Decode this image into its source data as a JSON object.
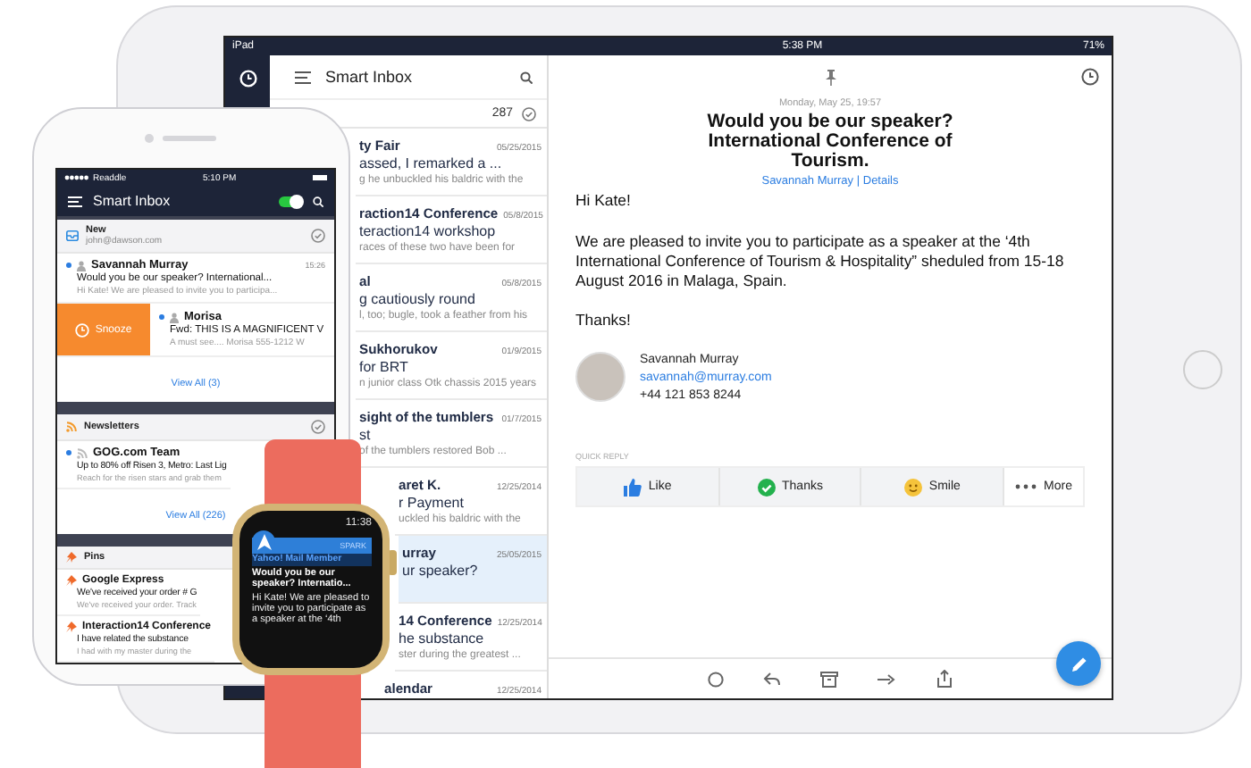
{
  "ipad": {
    "status_bar": {
      "device": "iPad",
      "time": "5:38 PM",
      "battery": "71%"
    },
    "inbox": {
      "title": "Smart Inbox",
      "count": "287",
      "messages": [
        {
          "sender": "ty Fair",
          "subject": "assed, I remarked a ...",
          "preview": "g he unbuckled his baldric with the",
          "date": "05/25/2015",
          "selected": false
        },
        {
          "sender": "raction14 Conference",
          "subject": "teraction14 workshop",
          "preview": "races of these two have been for",
          "date": "05/8/2015",
          "selected": false
        },
        {
          "sender": "al",
          "subject": "g cautiously round",
          "preview": "l, too; bugle, took a feather from his",
          "date": "05/8/2015",
          "selected": false
        },
        {
          "sender": "Sukhorukov",
          "subject": "for BRT",
          "preview": "n junior class Otk chassis 2015 years",
          "date": "01/9/2015",
          "selected": false
        },
        {
          "sender": "sight of the tumblers",
          "subject": "st",
          "preview": "of the tumblers restored Bob ...",
          "date": "01/7/2015",
          "selected": false
        },
        {
          "sender": "aret K.",
          "subject": "r Payment",
          "preview": "uckled his baldric with the",
          "date": "12/25/2014",
          "selected": false
        },
        {
          "sender": "urray",
          "subject": "ur speaker?",
          "date": "25/05/2015",
          "selected": true
        },
        {
          "sender": "14 Conference",
          "subject": "he substance",
          "preview": "ster during the greatest ...",
          "date": "12/25/2014",
          "selected": false
        },
        {
          "sender": "alendar",
          "date": "12/25/2014",
          "selected": false
        }
      ]
    },
    "email": {
      "date": "Monday, May 25, 19:57",
      "subject": "Would you be our speaker? International Conference of Tourism.",
      "sender_link": "Savannah Murray",
      "separator": "|",
      "details_link": "Details",
      "greeting": "Hi Kate!",
      "body": "We are pleased to invite you to participate as a speaker at the ‘4th International Conference of Tourism & Hospitality” sheduled from 15-18 August 2016 in Malaga, Spain.",
      "closing": "Thanks!",
      "signature": {
        "name": "Savannah Murray",
        "email": "savannah@murray.com",
        "phone": "+44 121 853 8244"
      },
      "quick_reply": {
        "label": "QUICK REPLY",
        "options": [
          {
            "kind": "like",
            "label": "Like"
          },
          {
            "kind": "thanks",
            "label": "Thanks"
          },
          {
            "kind": "smile",
            "label": "Smile"
          },
          {
            "kind": "more",
            "label": "More"
          }
        ]
      }
    }
  },
  "phone": {
    "status_bar": {
      "carrier": "Readdle",
      "time": "5:10 PM"
    },
    "title": "Smart Inbox",
    "toggle_on": true,
    "cards": [
      {
        "kind": "new",
        "title": "New",
        "subtitle": "john@dawson.com",
        "messages": [
          {
            "sender": "Savannah Murray",
            "time": "15:26",
            "subject": "Would you be our speaker? International...",
            "preview": "Hi Kate! We are pleased to invite you to participa...",
            "unread": true
          },
          {
            "sender": "Morisa",
            "subject": "Fwd: THIS IS A MAGNIFICENT V",
            "preview": "A must see.... Morisa 555-1212 W",
            "unread": true,
            "swipe_action": "Snooze"
          }
        ],
        "view_all": "View All (3)"
      },
      {
        "kind": "newsletters",
        "title": "Newsletters",
        "messages": [
          {
            "sender": "GOG.com Team",
            "subject": "Up to 80% off Risen 3, Metro: Last Lig",
            "preview": "Reach for the risen stars and grab them",
            "unread": true
          }
        ],
        "view_all": "View All (226)"
      },
      {
        "kind": "pins",
        "title": "Pins",
        "messages": [
          {
            "sender": "Google Express",
            "subject": "We've received your order # G",
            "preview": "We've received your order. Track"
          },
          {
            "sender": "Interaction14 Conference",
            "subject": "I have related the substance",
            "preview": "I had with my master during the"
          }
        ]
      }
    ]
  },
  "watch": {
    "time": "11:38",
    "app": "SPARK",
    "account": "Yahoo! Mail Member",
    "subject": "Would you be our speaker? Internatio...",
    "preview": "Hi Kate! We are pleased to invite you to participate as a speaker at the ‘4th"
  }
}
